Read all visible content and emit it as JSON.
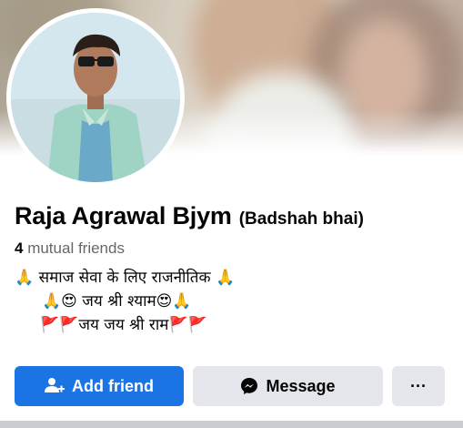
{
  "profile": {
    "name": "Raja Agrawal Bjym",
    "nickname": "(Badshah bhai)",
    "mutual_count": "4",
    "mutual_label": " mutual friends",
    "bio_lines": [
      "🙏 समाज सेवा के लिए राजनीतिक 🙏",
      "🙏😍 जय श्री श्याम😍🙏",
      "🚩🚩जय जय श्री राम🚩🚩"
    ]
  },
  "actions": {
    "add_friend_label": "Add friend",
    "message_label": "Message",
    "more_label": "···"
  },
  "icons": {
    "add_friend": "add-person-icon",
    "message": "messenger-icon"
  },
  "colors": {
    "primary_button": "#1b74e4",
    "secondary_button": "#e4e6eb",
    "muted_text": "#65676b"
  }
}
